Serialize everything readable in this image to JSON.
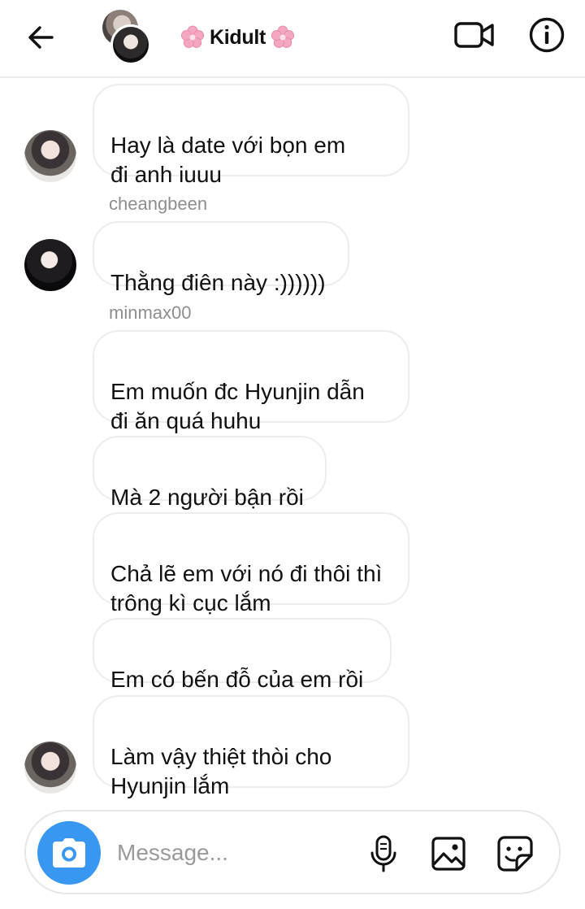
{
  "header": {
    "title": "Kidult",
    "icons": {
      "back": "arrow-left-icon",
      "video": "video-camera-icon",
      "info": "info-icon",
      "decoration": "cherry-blossom-icon"
    },
    "flower_color": "#f4a7c0"
  },
  "messages": [
    {
      "text": "Hay là date với bọn em\nđi anh iuuu"
    },
    {
      "sender": "cheangbeen",
      "text": "Thằng điên này :))))))"
    },
    {
      "sender": "minmax00",
      "text": "Em muốn đc Hyunjin dẫn\nđi ăn quá huhu"
    },
    {
      "text": "Mà 2 người bận rồi"
    },
    {
      "text": "Chả lẽ em với nó đi thôi thì\ntrông kì cục lắm"
    },
    {
      "text": "Em có bến đỗ của em rồi"
    },
    {
      "text": "Làm vậy thiệt thòi cho\nHyunjin lắm"
    }
  ],
  "composer": {
    "placeholder": "Message...",
    "accent": "#3897f0",
    "icons": [
      "camera-icon",
      "microphone-icon",
      "image-icon",
      "sticker-icon"
    ]
  }
}
